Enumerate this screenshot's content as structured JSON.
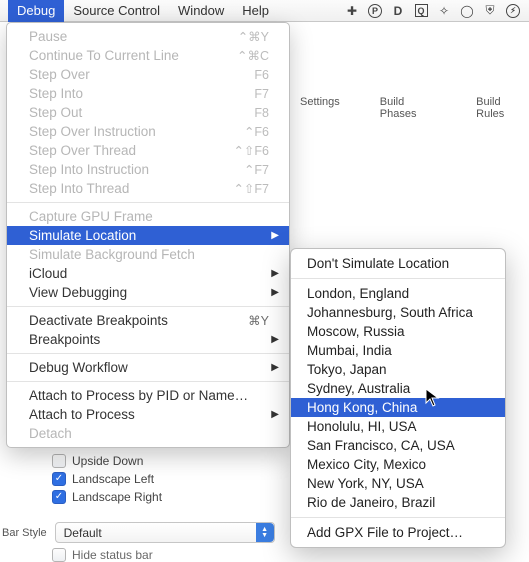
{
  "menubar": {
    "items": [
      "Debug",
      "Source Control",
      "Window",
      "Help"
    ],
    "active_index": 0
  },
  "menubar_icons": [
    "plus-icon",
    "p-icon",
    "d-icon",
    "q-icon",
    "dropbox-icon",
    "cloud-icon",
    "shield-icon",
    "bolt-icon"
  ],
  "debug_menu": {
    "groups": [
      [
        {
          "label": "Pause",
          "shortcut": "⌃⌘Y",
          "enabled": false
        },
        {
          "label": "Continue To Current Line",
          "shortcut": "⌃⌘C",
          "enabled": false
        },
        {
          "label": "Step Over",
          "shortcut": "F6",
          "enabled": false
        },
        {
          "label": "Step Into",
          "shortcut": "F7",
          "enabled": false
        },
        {
          "label": "Step Out",
          "shortcut": "F8",
          "enabled": false
        },
        {
          "label": "Step Over Instruction",
          "shortcut": "⌃F6",
          "enabled": false
        },
        {
          "label": "Step Over Thread",
          "shortcut": "⌃⇧F6",
          "enabled": false
        },
        {
          "label": "Step Into Instruction",
          "shortcut": "⌃F7",
          "enabled": false
        },
        {
          "label": "Step Into Thread",
          "shortcut": "⌃⇧F7",
          "enabled": false
        }
      ],
      [
        {
          "label": "Capture GPU Frame",
          "enabled": false
        },
        {
          "label": "Simulate Location",
          "enabled": true,
          "submenu": true,
          "highlighted": true
        },
        {
          "label": "Simulate Background Fetch",
          "enabled": false
        },
        {
          "label": "iCloud",
          "enabled": true,
          "submenu": true
        },
        {
          "label": "View Debugging",
          "enabled": true,
          "submenu": true
        }
      ],
      [
        {
          "label": "Deactivate Breakpoints",
          "shortcut": "⌘Y",
          "enabled": true
        },
        {
          "label": "Breakpoints",
          "enabled": true,
          "submenu": true
        }
      ],
      [
        {
          "label": "Debug Workflow",
          "enabled": true,
          "submenu": true
        }
      ],
      [
        {
          "label": "Attach to Process by PID or Name…",
          "enabled": true
        },
        {
          "label": "Attach to Process",
          "enabled": true,
          "submenu": true
        },
        {
          "label": "Detach",
          "enabled": false
        }
      ]
    ]
  },
  "location_submenu": {
    "groups": [
      [
        "Don't Simulate Location"
      ],
      [
        "London, England",
        "Johannesburg, South Africa",
        "Moscow, Russia",
        "Mumbai, India",
        "Tokyo, Japan",
        "Sydney, Australia",
        "Hong Kong, China",
        "Honolulu, HI, USA",
        "San Francisco, CA, USA",
        "Mexico City, Mexico",
        "New York, NY, USA",
        "Rio de Janeiro, Brazil"
      ],
      [
        "Add GPX File to Project…"
      ]
    ],
    "highlighted": "Hong Kong, China"
  },
  "bg_tabs": [
    "Settings",
    "Build Phases",
    "Build Rules"
  ],
  "orientation": {
    "items": [
      {
        "label": "Upside Down",
        "checked": false
      },
      {
        "label": "Landscape Left",
        "checked": true
      },
      {
        "label": "Landscape Right",
        "checked": true
      }
    ]
  },
  "bar_style": {
    "label": "Bar Style",
    "value": "Default"
  },
  "hide_status": {
    "label": "Hide status bar",
    "checked": false
  }
}
